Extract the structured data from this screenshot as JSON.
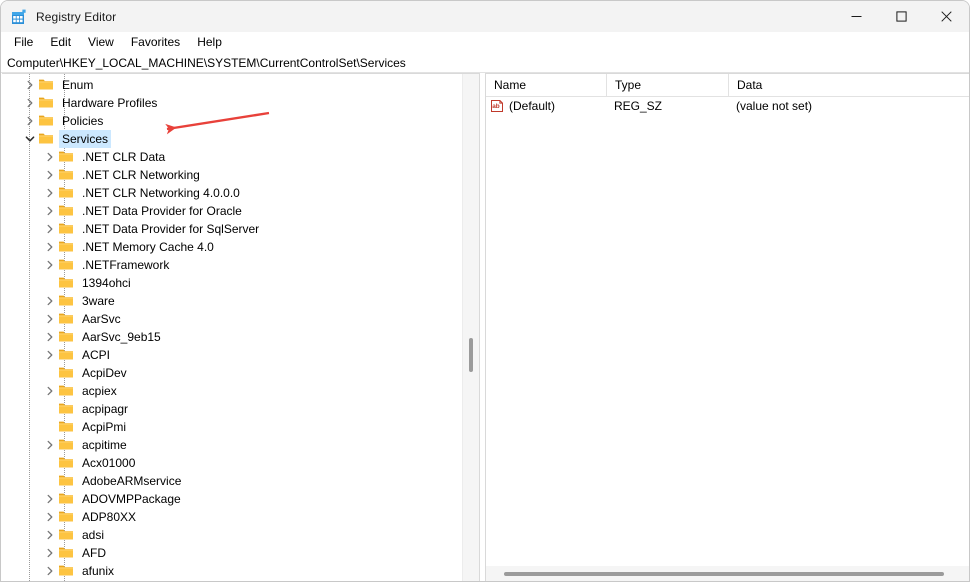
{
  "window": {
    "title": "Registry Editor",
    "app_icon": "registry-icon",
    "controls": {
      "minimize": "—",
      "maximize": "□",
      "close": "✕"
    }
  },
  "menu": {
    "items": [
      "File",
      "Edit",
      "View",
      "Favorites",
      "Help"
    ]
  },
  "address": {
    "path": "Computer\\HKEY_LOCAL_MACHINE\\SYSTEM\\CurrentControlSet\\Services"
  },
  "tree": {
    "items": [
      {
        "label": "Enum",
        "depth": 1,
        "expander": "collapsed",
        "selected": false
      },
      {
        "label": "Hardware Profiles",
        "depth": 1,
        "expander": "collapsed",
        "selected": false
      },
      {
        "label": "Policies",
        "depth": 1,
        "expander": "collapsed",
        "selected": false
      },
      {
        "label": "Services",
        "depth": 1,
        "expander": "expanded",
        "selected": true
      },
      {
        "label": ".NET CLR Data",
        "depth": 2,
        "expander": "collapsed",
        "selected": false
      },
      {
        "label": ".NET CLR Networking",
        "depth": 2,
        "expander": "collapsed",
        "selected": false
      },
      {
        "label": ".NET CLR Networking 4.0.0.0",
        "depth": 2,
        "expander": "collapsed",
        "selected": false
      },
      {
        "label": ".NET Data Provider for Oracle",
        "depth": 2,
        "expander": "collapsed",
        "selected": false
      },
      {
        "label": ".NET Data Provider for SqlServer",
        "depth": 2,
        "expander": "collapsed",
        "selected": false
      },
      {
        "label": ".NET Memory Cache 4.0",
        "depth": 2,
        "expander": "collapsed",
        "selected": false
      },
      {
        "label": ".NETFramework",
        "depth": 2,
        "expander": "collapsed",
        "selected": false
      },
      {
        "label": "1394ohci",
        "depth": 2,
        "expander": "none",
        "selected": false
      },
      {
        "label": "3ware",
        "depth": 2,
        "expander": "collapsed",
        "selected": false
      },
      {
        "label": "AarSvc",
        "depth": 2,
        "expander": "collapsed",
        "selected": false
      },
      {
        "label": "AarSvc_9eb15",
        "depth": 2,
        "expander": "collapsed",
        "selected": false
      },
      {
        "label": "ACPI",
        "depth": 2,
        "expander": "collapsed",
        "selected": false
      },
      {
        "label": "AcpiDev",
        "depth": 2,
        "expander": "none",
        "selected": false
      },
      {
        "label": "acpiex",
        "depth": 2,
        "expander": "collapsed",
        "selected": false
      },
      {
        "label": "acpipagr",
        "depth": 2,
        "expander": "none",
        "selected": false
      },
      {
        "label": "AcpiPmi",
        "depth": 2,
        "expander": "none",
        "selected": false
      },
      {
        "label": "acpitime",
        "depth": 2,
        "expander": "collapsed",
        "selected": false
      },
      {
        "label": "Acx01000",
        "depth": 2,
        "expander": "none",
        "selected": false
      },
      {
        "label": "AdobeARMservice",
        "depth": 2,
        "expander": "none",
        "selected": false
      },
      {
        "label": "ADOVMPPackage",
        "depth": 2,
        "expander": "collapsed",
        "selected": false
      },
      {
        "label": "ADP80XX",
        "depth": 2,
        "expander": "collapsed",
        "selected": false
      },
      {
        "label": "adsi",
        "depth": 2,
        "expander": "collapsed",
        "selected": false
      },
      {
        "label": "AFD",
        "depth": 2,
        "expander": "collapsed",
        "selected": false
      },
      {
        "label": "afunix",
        "depth": 2,
        "expander": "collapsed",
        "selected": false
      }
    ]
  },
  "values": {
    "columns": [
      "Name",
      "Type",
      "Data"
    ],
    "rows": [
      {
        "icon": "string-value-icon",
        "name": "(Default)",
        "type": "REG_SZ",
        "data": "(value not set)"
      }
    ]
  },
  "annotation": {
    "type": "arrow",
    "color": "#e8413a",
    "points_to": "Services"
  },
  "colors": {
    "selection": "#cce8ff",
    "folder": "#fdc441",
    "accent": "#0078d4",
    "annotation": "#e8413a"
  }
}
